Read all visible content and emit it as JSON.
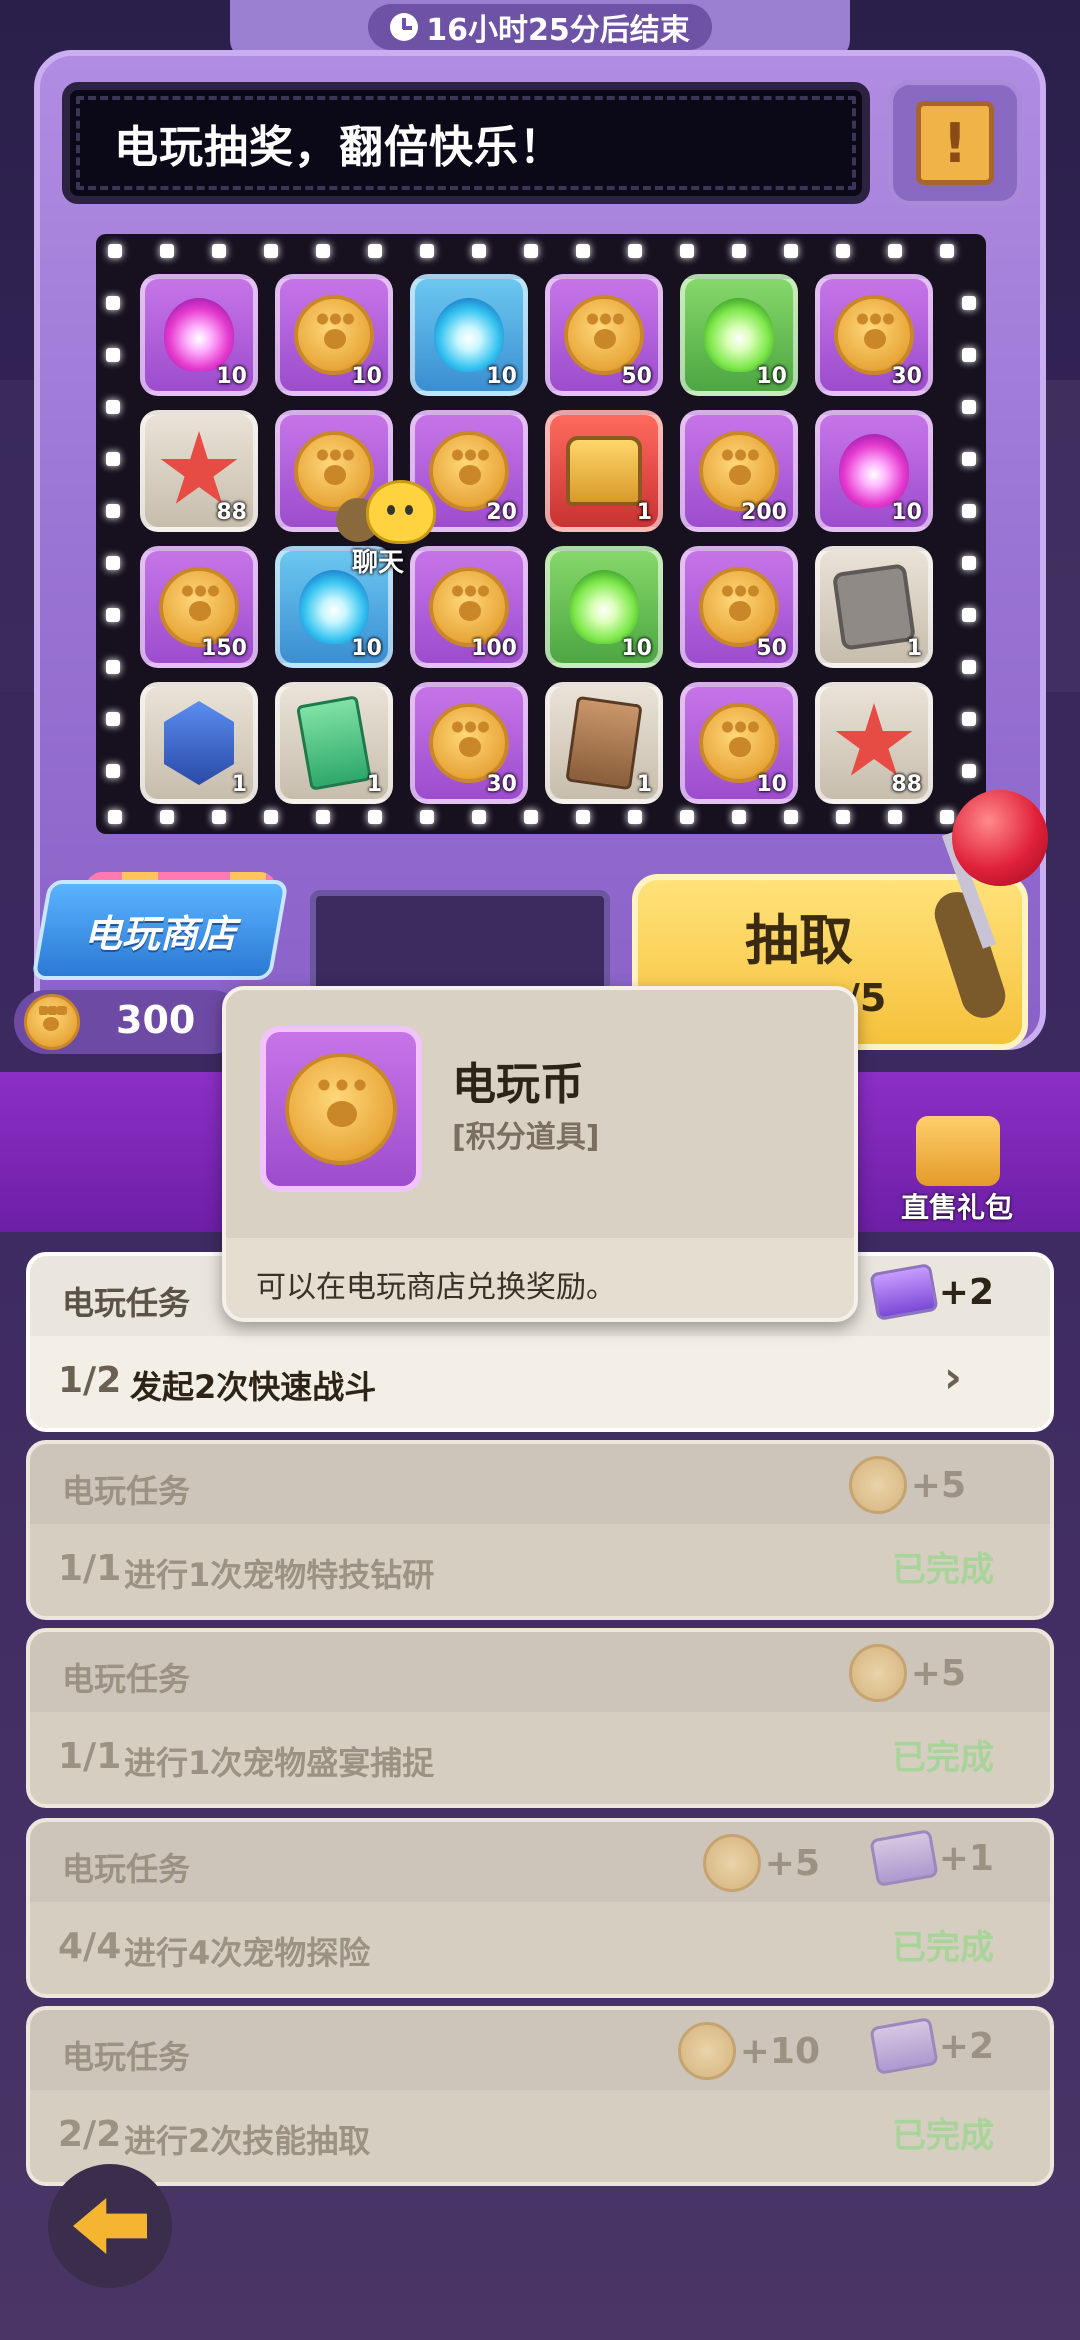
{
  "timer": {
    "text": "16小时25分后结束",
    "icon": "clock-icon"
  },
  "banner": {
    "text": "电玩抽奖，翻倍快乐！"
  },
  "info_button": {
    "icon": "scroll-info-icon"
  },
  "grid": [
    {
      "type": "orb-pink",
      "bg": "purple",
      "count": "10"
    },
    {
      "type": "coin",
      "bg": "purple",
      "count": "10"
    },
    {
      "type": "orb-cyan",
      "bg": "blue",
      "count": "10"
    },
    {
      "type": "coin",
      "bg": "purple",
      "count": "50"
    },
    {
      "type": "orb-lime",
      "bg": "green",
      "count": "10"
    },
    {
      "type": "coin",
      "bg": "purple",
      "count": "30"
    },
    {
      "type": "starfish",
      "bg": "gray",
      "count": "88"
    },
    {
      "type": "coin",
      "bg": "purple",
      "count": ""
    },
    {
      "type": "coin",
      "bg": "purple",
      "count": "20"
    },
    {
      "type": "chest",
      "bg": "red",
      "count": "1"
    },
    {
      "type": "coin",
      "bg": "purple",
      "count": "200"
    },
    {
      "type": "orb-pink",
      "bg": "purple",
      "count": "10"
    },
    {
      "type": "coin",
      "bg": "purple",
      "count": "150"
    },
    {
      "type": "orb-cyan",
      "bg": "blue",
      "count": "10"
    },
    {
      "type": "coin",
      "bg": "purple",
      "count": "100"
    },
    {
      "type": "orb-lime",
      "bg": "green",
      "count": "10"
    },
    {
      "type": "coin",
      "bg": "purple",
      "count": "50"
    },
    {
      "type": "stone",
      "bg": "gray",
      "count": "1"
    },
    {
      "type": "crystal",
      "bg": "gray",
      "count": "1"
    },
    {
      "type": "ticket",
      "bg": "gray",
      "count": "1"
    },
    {
      "type": "coin",
      "bg": "purple",
      "count": "30"
    },
    {
      "type": "card",
      "bg": "gray",
      "count": "1"
    },
    {
      "type": "coin",
      "bg": "purple",
      "count": "10"
    },
    {
      "type": "starfish",
      "bg": "gray",
      "count": "88"
    }
  ],
  "chat": {
    "label": "聊天"
  },
  "shop": {
    "label": "电玩商店"
  },
  "coins": {
    "count": "300"
  },
  "draw": {
    "label": "抽取",
    "count": "/5"
  },
  "gift": {
    "label": "直售礼包"
  },
  "tooltip": {
    "title": "电玩币",
    "subtitle": "[积分道具]",
    "description": "可以在电玩商店兑换奖励。"
  },
  "tasks": [
    {
      "title": "电玩任务",
      "progress": "1/2",
      "desc": "发起2次快速战斗",
      "status": "",
      "active": true,
      "rewards": [
        {
          "kind": "gem",
          "amount": "+2"
        }
      ]
    },
    {
      "title": "电玩任务",
      "progress": "1/1",
      "desc": "进行1次宠物特技钻研",
      "status": "已完成",
      "active": false,
      "rewards": [
        {
          "kind": "coin",
          "amount": "+5"
        }
      ]
    },
    {
      "title": "电玩任务",
      "progress": "1/1",
      "desc": "进行1次宠物盛宴捕捉",
      "status": "已完成",
      "active": false,
      "rewards": [
        {
          "kind": "coin",
          "amount": "+5"
        }
      ]
    },
    {
      "title": "电玩任务",
      "progress": "4/4",
      "desc": "进行4次宠物探险",
      "status": "已完成",
      "active": false,
      "rewards": [
        {
          "kind": "coin",
          "amount": "+5"
        },
        {
          "kind": "gem",
          "amount": "+1"
        }
      ]
    },
    {
      "title": "电玩任务",
      "progress": "2/2",
      "desc": "进行2次技能抽取",
      "status": "已完成",
      "active": false,
      "rewards": [
        {
          "kind": "coin",
          "amount": "+10"
        },
        {
          "kind": "gem",
          "amount": "+2"
        }
      ]
    }
  ],
  "colors": {
    "accent": "#9b7fd1",
    "draw_button": "#f6c13b",
    "done": "#a8d49a"
  }
}
